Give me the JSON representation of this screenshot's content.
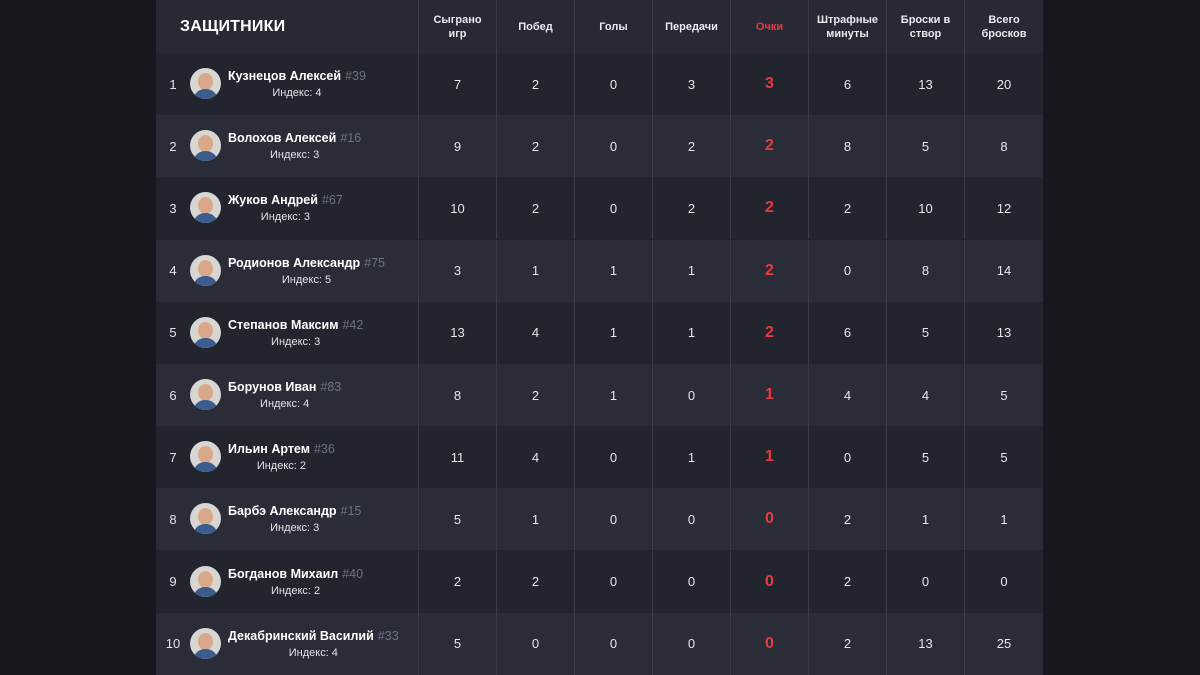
{
  "table": {
    "section_title": "ЗАЩИТНИКИ",
    "columns": [
      {
        "key": "games",
        "label": "Сыграно игр"
      },
      {
        "key": "wins",
        "label": "Побед"
      },
      {
        "key": "goals",
        "label": "Голы"
      },
      {
        "key": "assists",
        "label": "Передачи"
      },
      {
        "key": "points",
        "label": "Очки"
      },
      {
        "key": "pim",
        "label": "Штрафные минуты"
      },
      {
        "key": "sog",
        "label": "Броски в створ"
      },
      {
        "key": "shots",
        "label": "Всего бросков"
      }
    ],
    "rows": [
      {
        "rank": "1",
        "name": "Кузнецов Алексей",
        "number": "#39",
        "index": "Индекс: 4",
        "games": "7",
        "wins": "2",
        "goals": "0",
        "assists": "3",
        "points": "3",
        "pim": "6",
        "sog": "13",
        "shots": "20"
      },
      {
        "rank": "2",
        "name": "Волохов Алексей",
        "number": "#16",
        "index": "Индекс: 3",
        "games": "9",
        "wins": "2",
        "goals": "0",
        "assists": "2",
        "points": "2",
        "pim": "8",
        "sog": "5",
        "shots": "8"
      },
      {
        "rank": "3",
        "name": "Жуков Андрей",
        "number": "#67",
        "index": "Индекс: 3",
        "games": "10",
        "wins": "2",
        "goals": "0",
        "assists": "2",
        "points": "2",
        "pim": "2",
        "sog": "10",
        "shots": "12"
      },
      {
        "rank": "4",
        "name": "Родионов Александр",
        "number": "#75",
        "index": "Индекс: 5",
        "games": "3",
        "wins": "1",
        "goals": "1",
        "assists": "1",
        "points": "2",
        "pim": "0",
        "sog": "8",
        "shots": "14"
      },
      {
        "rank": "5",
        "name": "Степанов Максим",
        "number": "#42",
        "index": "Индекс: 3",
        "games": "13",
        "wins": "4",
        "goals": "1",
        "assists": "1",
        "points": "2",
        "pim": "6",
        "sog": "5",
        "shots": "13"
      },
      {
        "rank": "6",
        "name": "Борунов Иван",
        "number": "#83",
        "index": "Индекс: 4",
        "games": "8",
        "wins": "2",
        "goals": "1",
        "assists": "0",
        "points": "1",
        "pim": "4",
        "sog": "4",
        "shots": "5"
      },
      {
        "rank": "7",
        "name": "Ильин Артем",
        "number": "#36",
        "index": "Индекс: 2",
        "games": "11",
        "wins": "4",
        "goals": "0",
        "assists": "1",
        "points": "1",
        "pim": "0",
        "sog": "5",
        "shots": "5"
      },
      {
        "rank": "8",
        "name": "Барбэ Александр",
        "number": "#15",
        "index": "Индекс: 3",
        "games": "5",
        "wins": "1",
        "goals": "0",
        "assists": "0",
        "points": "0",
        "pim": "2",
        "sog": "1",
        "shots": "1"
      },
      {
        "rank": "9",
        "name": "Богданов Михаил",
        "number": "#40",
        "index": "Индекс: 2",
        "games": "2",
        "wins": "2",
        "goals": "0",
        "assists": "0",
        "points": "0",
        "pim": "2",
        "sog": "0",
        "shots": "0"
      },
      {
        "rank": "10",
        "name": "Декабринский Василий",
        "number": "#33",
        "index": "Индекс: 4",
        "games": "5",
        "wins": "0",
        "goals": "0",
        "assists": "0",
        "points": "0",
        "pim": "2",
        "sog": "13",
        "shots": "25"
      }
    ]
  },
  "colors": {
    "page_background": "#17171d",
    "panel_background": "#21232d",
    "header_background": "#272a35",
    "row_alt_background": "#2a2d38",
    "accent_points": "#e8393e",
    "muted_number": "#6f7280"
  }
}
